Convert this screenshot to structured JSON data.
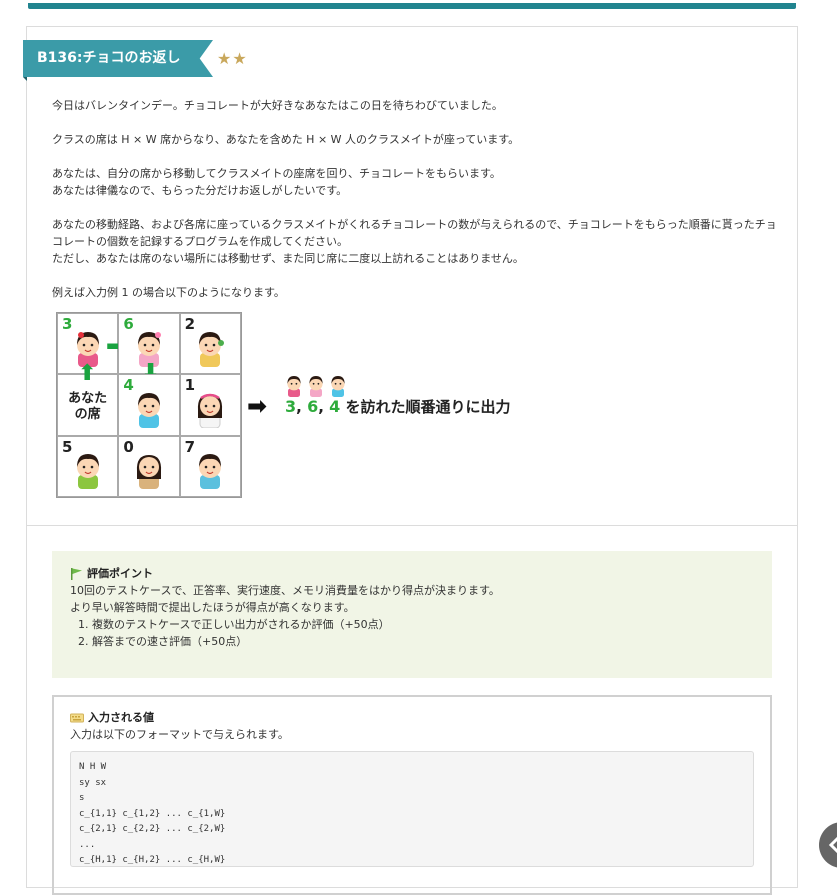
{
  "problem": {
    "title": "B136:チョコのお返し",
    "stars": "★★"
  },
  "description": [
    [
      "今日はバレンタインデー。チョコレートが大好きなあなたはこの日を待ちわびていました。"
    ],
    [
      "クラスの席は H × W 席からなり、あなたを含めた H × W 人のクラスメイトが座っています。"
    ],
    [
      "あなたは、自分の席から移動してクラスメイトの座席を回り、チョコレートをもらいます。",
      "あなたは律儀なので、もらった分だけお返しがしたいです。"
    ],
    [
      "あなたの移動経路、および各席に座っているクラスメイトがくれるチョコレートの数が与えられるので、チョコレートをもらった順番に貰ったチョコレートの個数を記録するプログラムを作成してください。",
      "ただし、あなたは席のない場所には移動せず、また同じ席に二度以上訪れることはありません。"
    ],
    [
      "例えば入力例 1 の場合以下のようになります。"
    ]
  ],
  "figure": {
    "cells": [
      "3",
      "6",
      "2",
      "",
      "4",
      "1",
      "5",
      "0",
      "7"
    ],
    "seat_label_line1": "あなた",
    "seat_label_line2": "の席",
    "result_nums": [
      "3",
      "6",
      "4"
    ],
    "result_sep": ",",
    "result_suffix": "を訪れた順番通りに出力"
  },
  "evaluation": {
    "heading": "評価ポイント",
    "lines": [
      "10回のテストケースで、正答率、実行速度、メモリ消費量をはかり得点が決まります。",
      "より早い解答時間で提出したほうが得点が高くなります。"
    ],
    "items": [
      "複数のテストケースで正しい出力がされるか評価（+50点）",
      "解答までの速さ評価（+50点）"
    ]
  },
  "input": {
    "heading": "入力される値",
    "intro": "入力は以下のフォーマットで与えられます。",
    "code": [
      "N H W",
      "sy sx",
      "s",
      "c_{1,1} c_{1,2} ... c_{1,W}",
      "c_{2,1} c_{2,2} ... c_{2,W}",
      "...",
      "c_{H,1} c_{H,2} ... c_{H,W}"
    ]
  },
  "colors": {
    "accent": "#3b9ba8",
    "topbar": "#21848f",
    "green": "#2eab3c",
    "eval_bg": "#f1f5e6",
    "star": "#c9a85c"
  }
}
